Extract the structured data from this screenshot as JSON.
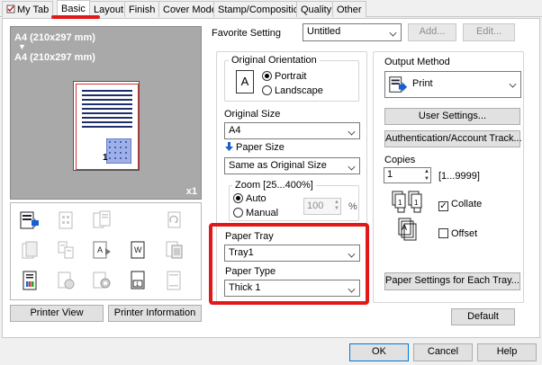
{
  "tabs": [
    {
      "label": "My Tab"
    },
    {
      "label": "Basic"
    },
    {
      "label": "Layout"
    },
    {
      "label": "Finish"
    },
    {
      "label": "Cover Mode"
    },
    {
      "label": "Stamp/Composition"
    },
    {
      "label": "Quality"
    },
    {
      "label": "Other"
    }
  ],
  "preview": {
    "paper_line1": "A4 (210x297 mm)",
    "arrow": "▼",
    "paper_line2": "A4 (210x297 mm)",
    "copies_badge": "x1",
    "page_number": "1",
    "printer_view_label": "Printer View",
    "printer_info_label": "Printer Information"
  },
  "favorite": {
    "label": "Favorite Setting",
    "value": "Untitled",
    "add_label": "Add...",
    "edit_label": "Edit..."
  },
  "orientation": {
    "legend": "Original Orientation",
    "portrait_label": "Portrait",
    "landscape_label": "Landscape",
    "icon_letter": "A"
  },
  "original_size": {
    "label": "Original Size",
    "value": "A4"
  },
  "paper_size": {
    "label": "Paper Size",
    "value": "Same as Original Size"
  },
  "zoom": {
    "legend": "Zoom [25...400%]",
    "auto_label": "Auto",
    "manual_label": "Manual",
    "value": "100",
    "unit": "%"
  },
  "paper_tray": {
    "label": "Paper Tray",
    "value": "Tray1"
  },
  "paper_type": {
    "label": "Paper Type",
    "value": "Thick 1"
  },
  "output_method": {
    "label": "Output Method",
    "value": "Print"
  },
  "user_settings_label": "User Settings...",
  "auth_label": "Authentication/Account Track...",
  "copies": {
    "label": "Copies",
    "value": "1",
    "range": "[1...9999]",
    "collate_label": "Collate",
    "offset_label": "Offset"
  },
  "paper_settings_tray_label": "Paper Settings for Each Tray...",
  "default_label": "Default",
  "footer": {
    "ok_label": "OK",
    "cancel_label": "Cancel",
    "help_label": "Help"
  },
  "colors": {
    "highlight_red": "#e21818",
    "preview_bg": "#a9a9a9",
    "blue_accent": "#1a5fd0"
  }
}
